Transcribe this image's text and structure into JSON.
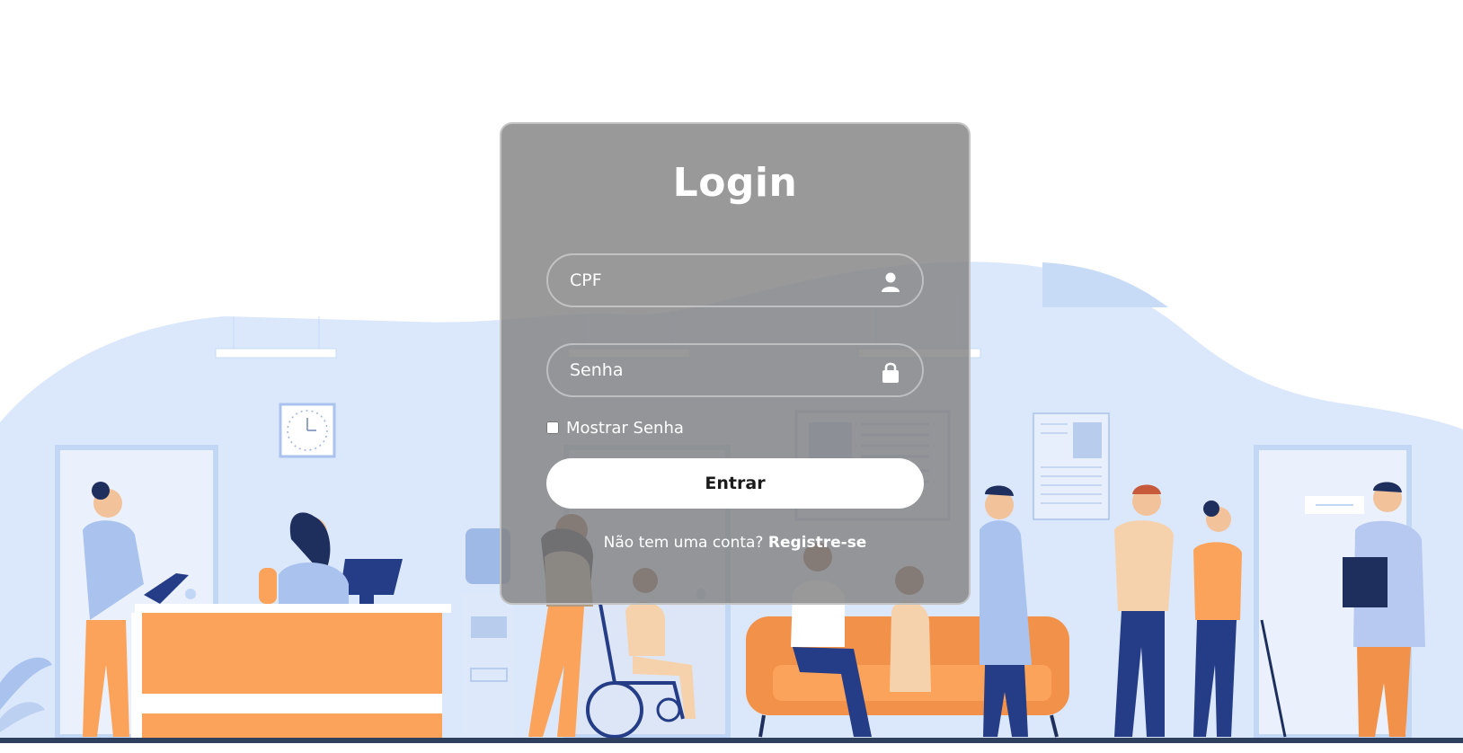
{
  "login": {
    "title": "Login",
    "cpf_placeholder": "CPF",
    "password_placeholder": "Senha",
    "show_password_label": "Mostrar Senha",
    "show_password_checked": false,
    "submit_label": "Entrar",
    "register_prompt": "Não tem uma conta?",
    "register_link": "Registre-se"
  },
  "icons": {
    "cpf": "user-icon",
    "password": "lock-icon"
  },
  "colors": {
    "accent_orange": "#fca35b",
    "navy": "#253d86",
    "light_blue": "#dbe7fb",
    "card_bg": "#8a8a8a",
    "button_bg": "#ffffff"
  }
}
